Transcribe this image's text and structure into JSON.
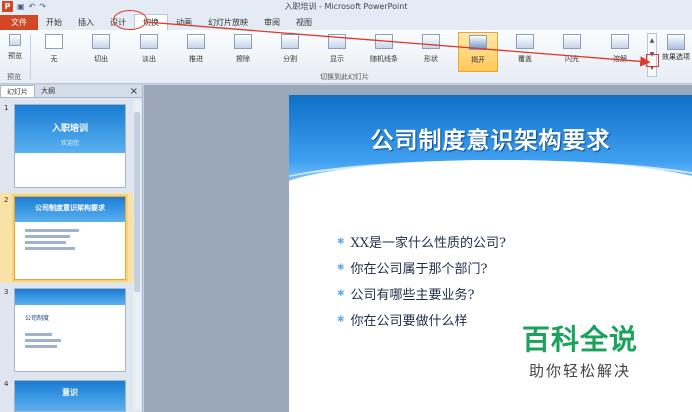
{
  "window": {
    "title": "入职培训 - Microsoft PowerPoint",
    "qat": [
      "save-icon",
      "undo-icon",
      "redo-icon"
    ]
  },
  "tabs": [
    "文件",
    "开始",
    "插入",
    "设计",
    "切换",
    "动画",
    "幻灯片放映",
    "审阅",
    "视图"
  ],
  "ribbon": {
    "preview": "预览",
    "preview_group": "预览",
    "transitions": [
      "无",
      "切出",
      "淡出",
      "推进",
      "擦除",
      "分割",
      "显示",
      "随机线条",
      "形状",
      "揭开",
      "覆盖",
      "闪光",
      "溶解"
    ],
    "selected": "揭开",
    "transitions_group": "切换到此幻灯片",
    "effect_options": "效果选项"
  },
  "panel": {
    "tabs": [
      "幻灯片",
      "大纲"
    ],
    "close": "×"
  },
  "thumbs": [
    {
      "num": "1",
      "title": "入职培训",
      "subtitle": "欢迎您"
    },
    {
      "num": "2",
      "title": "公司制度意识架构要求"
    },
    {
      "num": "3",
      "title": "公司制度"
    },
    {
      "num": "4",
      "title": "意识"
    }
  ],
  "slide": {
    "title": "公司制度意识架构要求",
    "bullets": [
      "XX是一家什么性质的公司?",
      "你在公司属于那个部门?",
      "公司有哪些主要业务?",
      "你在公司要做什么样"
    ]
  },
  "watermark": {
    "brand": "百科全说",
    "tagline": "助你轻松解决"
  }
}
